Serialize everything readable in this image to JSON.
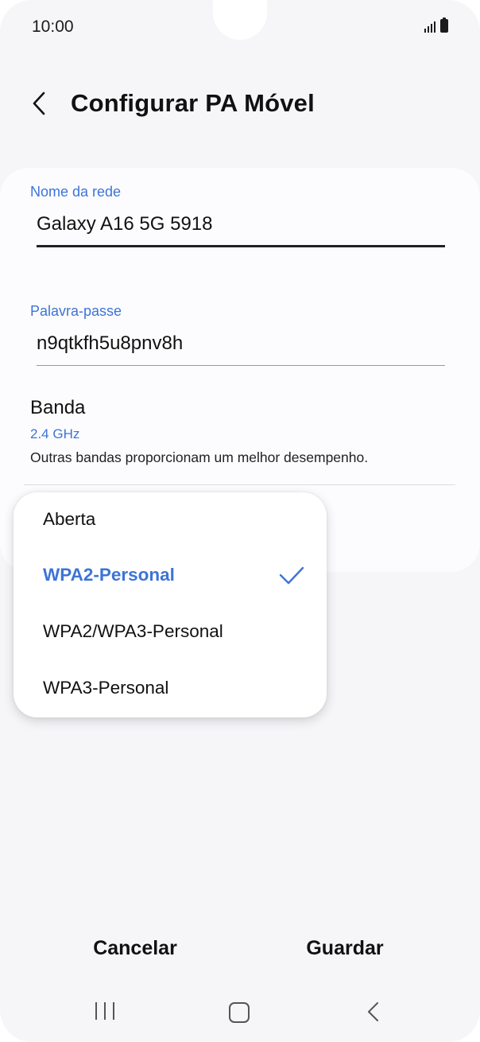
{
  "status_bar": {
    "time": "10:00"
  },
  "header": {
    "title": "Configurar PA Móvel",
    "back_icon": "chevron-left-icon"
  },
  "network_name": {
    "label": "Nome da rede",
    "value": "Galaxy A16 5G 5918"
  },
  "password": {
    "label": "Palavra-passe",
    "value": "n9qtkfh5u8pnv8h"
  },
  "band": {
    "title": "Banda",
    "value": "2.4 GHz",
    "description": "Outras bandas proporcionam um melhor desempenho."
  },
  "security_dropdown": {
    "options": [
      {
        "label": "Aberta",
        "selected": false
      },
      {
        "label": "WPA2-Personal",
        "selected": true
      },
      {
        "label": "WPA2/WPA3-Personal",
        "selected": false
      },
      {
        "label": "WPA3-Personal",
        "selected": false
      }
    ]
  },
  "actions": {
    "cancel_label": "Cancelar",
    "save_label": "Guardar"
  },
  "colors": {
    "accent": "#3d74d6",
    "background": "#f6f6f9",
    "card": "#fcfcfe"
  }
}
